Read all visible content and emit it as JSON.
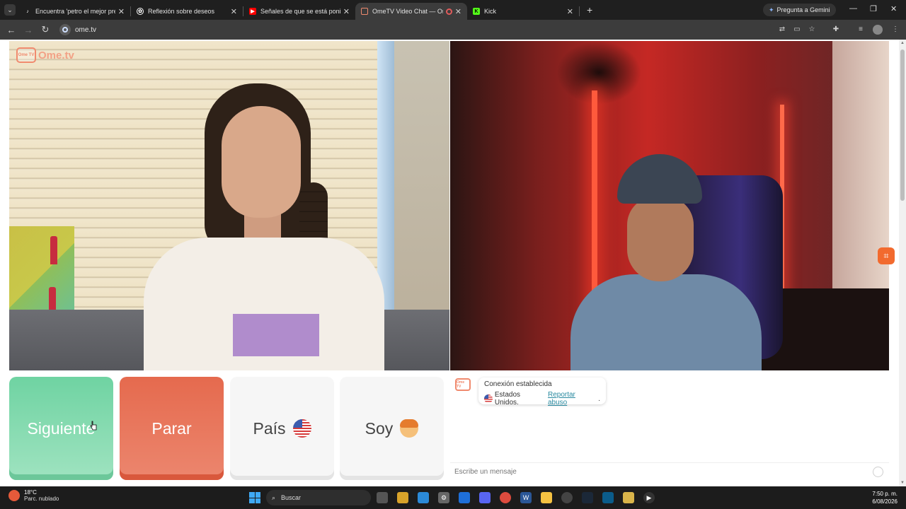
{
  "browser": {
    "tabs": [
      {
        "title": "Encuentra 'petro el mejor presi",
        "icon": "tiktok-icon",
        "active": false
      },
      {
        "title": "Reflexión sobre deseos",
        "icon": "chatgpt-icon",
        "active": false
      },
      {
        "title": "Señales de que se está ponienc",
        "icon": "youtube-icon",
        "active": false
      },
      {
        "title": "OmeTV Video Chat — Ome",
        "icon": "ometv-icon",
        "active": true
      },
      {
        "title": "Kick",
        "icon": "kick-icon",
        "active": false
      }
    ],
    "gemini_label": "Pregunta a Gemini",
    "url": "ome.tv"
  },
  "app": {
    "logo_text": "Ome.tv",
    "logo_badge": "Ome TV",
    "buttons": {
      "next": "Siguiente",
      "stop": "Parar",
      "country": "País",
      "gender": "Soy"
    },
    "chat": {
      "connection": "Conexión establecida",
      "country": "Estados Unidos.",
      "report": "Reportar abuso",
      "report_suffix": ".",
      "input_placeholder": "Escribe un mensaje"
    }
  },
  "taskbar": {
    "temperature": "18°C",
    "weather": "Parc. nublado",
    "search_label": "Buscar",
    "time": "7:50 p. m.",
    "date": "6/08/2026"
  },
  "colors": {
    "next_button": "#6fd3a2",
    "stop_button": "#e56a4e",
    "brand": "#f08a6e",
    "report_link": "#2a8aa0"
  }
}
